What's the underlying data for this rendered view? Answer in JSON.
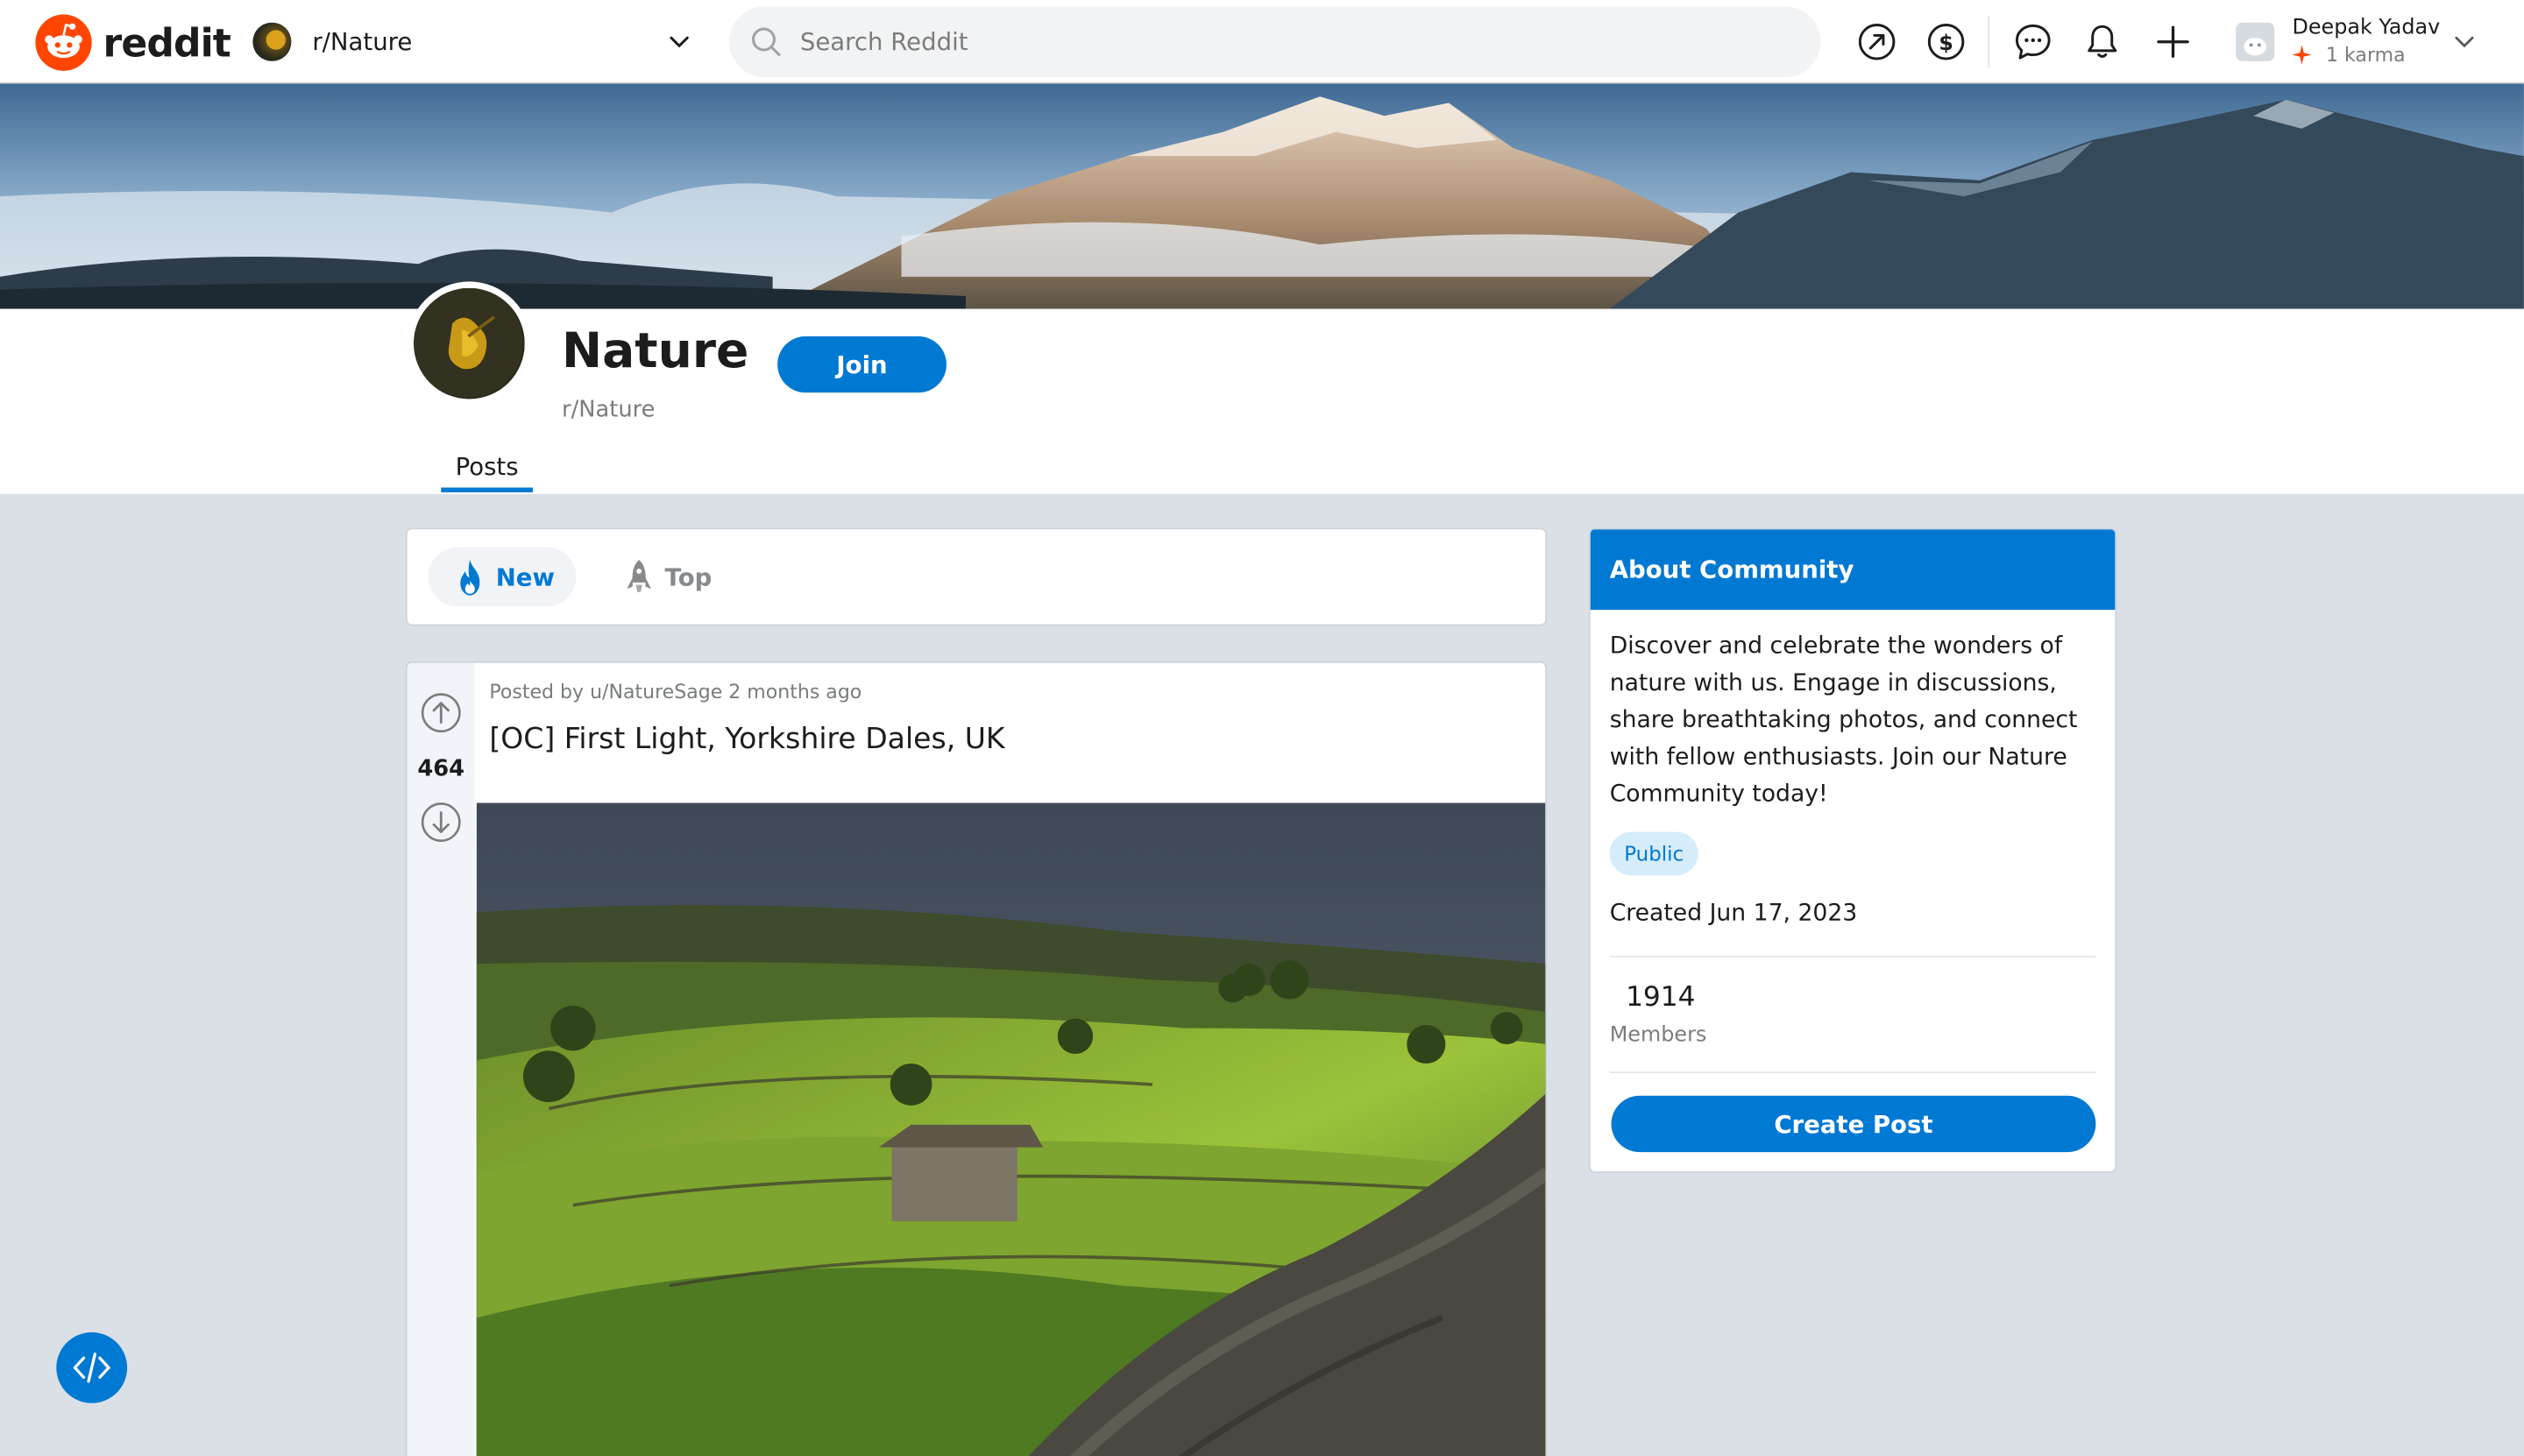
{
  "header": {
    "brand": "reddit",
    "community": "r/Nature",
    "search_placeholder": "Search Reddit",
    "icons": [
      "popular-icon",
      "coins-icon",
      "chat-icon",
      "notification-icon",
      "create-icon"
    ],
    "user": {
      "name": "Deepak Yadav",
      "karma": "1 karma"
    }
  },
  "community": {
    "title": "Nature",
    "handle": "r/Nature",
    "join_label": "Join",
    "tabs": [
      {
        "label": "Posts"
      }
    ]
  },
  "sort": {
    "options": [
      {
        "label": "New",
        "active": true,
        "icon": "flame-icon"
      },
      {
        "label": "Top",
        "active": false,
        "icon": "rocket-icon"
      }
    ]
  },
  "post": {
    "votes": "464",
    "meta": "Posted by u/NatureSage 2 months ago",
    "title": "[OC] First Light, Yorkshire Dales, UK"
  },
  "about": {
    "heading": "About Community",
    "description": "Discover and celebrate the wonders of nature with us. Engage in discussions, share breathtaking photos, and connect with fellow enthusiasts. Join our Nature Community today!",
    "visibility": "Public",
    "created": "Created Jun 17, 2023",
    "members_count": "1914",
    "members_label": "Members",
    "create_post_label": "Create Post"
  },
  "colors": {
    "accent": "#0079d3",
    "brand": "#ff4500",
    "page_bg": "#dae0e6"
  }
}
